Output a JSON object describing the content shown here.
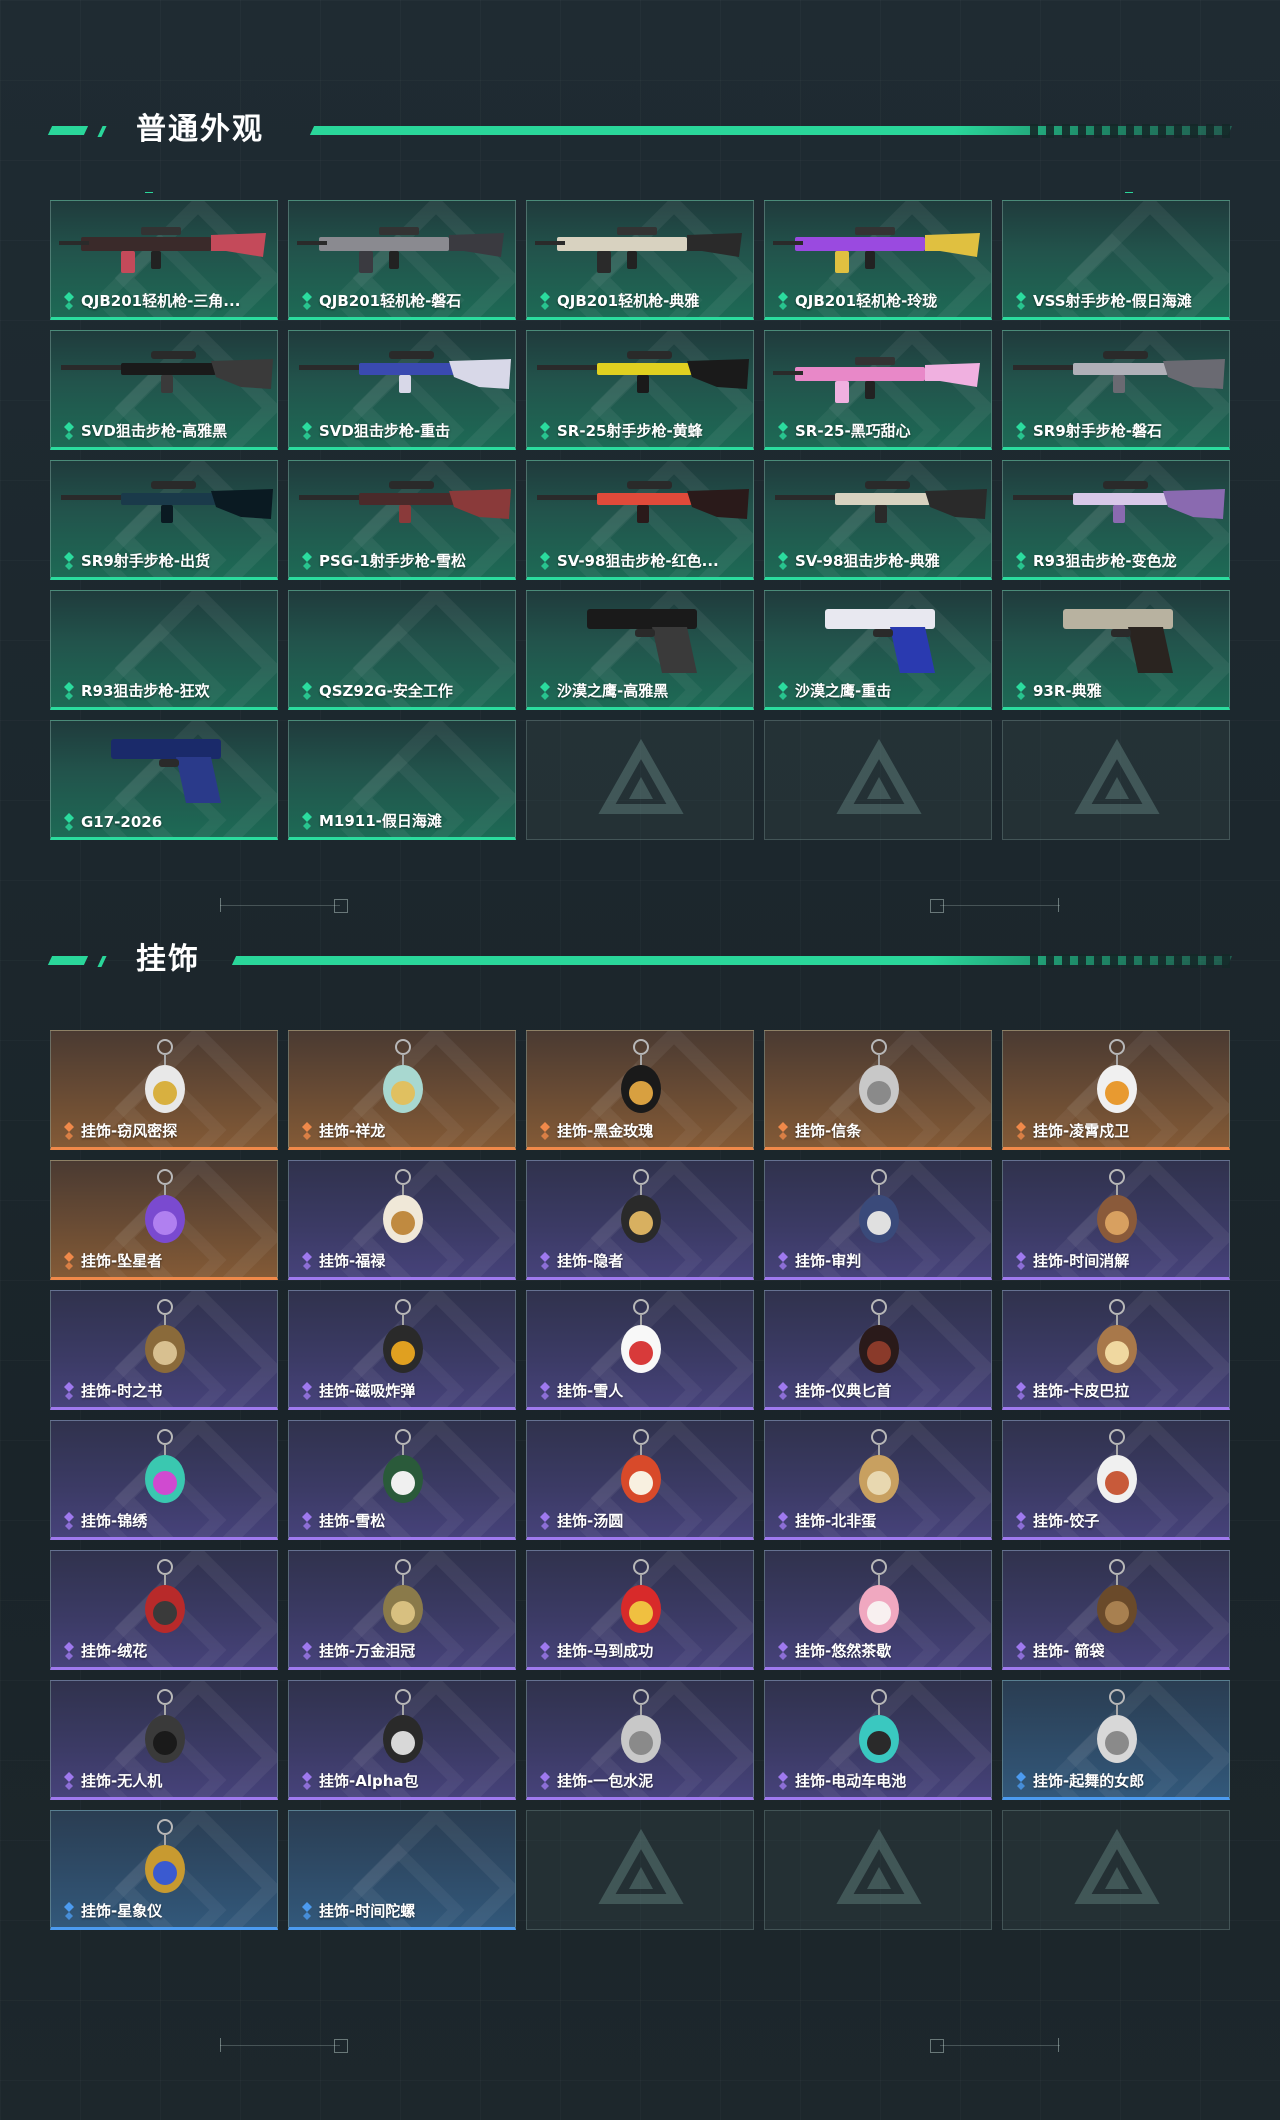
{
  "sections": {
    "skins": {
      "title": "普通外观",
      "items": [
        {
          "label": "QJB201轻机枪-三角...",
          "rarity": "green",
          "art": "rifle",
          "colors": [
            "#3a2a2a",
            "#c44a5a"
          ]
        },
        {
          "label": "QJB201轻机枪-磐石",
          "rarity": "green",
          "art": "rifle",
          "colors": [
            "#8a8a90",
            "#3a3a40"
          ]
        },
        {
          "label": "QJB201轻机枪-典雅",
          "rarity": "green",
          "art": "rifle",
          "colors": [
            "#d8d2c0",
            "#2a2a2a"
          ]
        },
        {
          "label": "QJB201轻机枪-玲珑",
          "rarity": "green",
          "art": "rifle",
          "colors": [
            "#9a4ae0",
            "#e0c040"
          ]
        },
        {
          "label": "VSS射手步枪-假日海滩",
          "rarity": "green",
          "art": "none",
          "colors": []
        },
        {
          "label": "SVD狙击步枪-高雅黑",
          "rarity": "green",
          "art": "sniper",
          "colors": [
            "#1a1a1a",
            "#3a3a3a"
          ]
        },
        {
          "label": "SVD狙击步枪-重击",
          "rarity": "green",
          "art": "sniper",
          "colors": [
            "#3a4ab0",
            "#d8d8e8"
          ]
        },
        {
          "label": "SR-25射手步枪-黄蜂",
          "rarity": "green",
          "art": "sniper",
          "colors": [
            "#e0d020",
            "#1a1a1a"
          ]
        },
        {
          "label": "SR-25-黑巧甜心",
          "rarity": "green",
          "art": "rifle",
          "colors": [
            "#e888c8",
            "#f0b0e0"
          ]
        },
        {
          "label": "SR9射手步枪-磐石",
          "rarity": "green",
          "art": "sniper",
          "colors": [
            "#b0b0b8",
            "#6a6a72"
          ]
        },
        {
          "label": "SR9射手步枪-出货",
          "rarity": "green",
          "art": "sniper",
          "colors": [
            "#1a3a4a",
            "#0a1a22"
          ]
        },
        {
          "label": "PSG-1射手步枪-雪松",
          "rarity": "green",
          "art": "sniper",
          "colors": [
            "#4a2a2a",
            "#8a3a3a"
          ]
        },
        {
          "label": "SV-98狙击步枪-红色...",
          "rarity": "green",
          "art": "sniper",
          "colors": [
            "#e04a3a",
            "#2a1a1a"
          ]
        },
        {
          "label": "SV-98狙击步枪-典雅",
          "rarity": "green",
          "art": "sniper",
          "colors": [
            "#d8d2c0",
            "#2a2a2a"
          ]
        },
        {
          "label": "R93狙击步枪-变色龙",
          "rarity": "green",
          "art": "sniper",
          "colors": [
            "#d8c8e8",
            "#8a6ab0"
          ]
        },
        {
          "label": "R93狙击步枪-狂欢",
          "rarity": "green",
          "art": "none",
          "colors": []
        },
        {
          "label": "QSZ92G-安全工作",
          "rarity": "green",
          "art": "none",
          "colors": []
        },
        {
          "label": "沙漠之鹰-高雅黑",
          "rarity": "green",
          "art": "pistol",
          "colors": [
            "#1a1a1a",
            "#3a3a3a"
          ]
        },
        {
          "label": "沙漠之鹰-重击",
          "rarity": "green",
          "art": "pistol",
          "colors": [
            "#e8e8f0",
            "#2a3ab0"
          ]
        },
        {
          "label": "93R-典雅",
          "rarity": "green",
          "art": "pistol",
          "colors": [
            "#b8b2a0",
            "#2a2420"
          ]
        },
        {
          "label": "G17-2026",
          "rarity": "green",
          "art": "pistol",
          "colors": [
            "#1a2a6a",
            "#2a3a8a"
          ]
        },
        {
          "label": "M1911-假日海滩",
          "rarity": "green",
          "art": "none",
          "colors": []
        },
        {
          "label": "",
          "rarity": "empty",
          "art": "logo",
          "colors": []
        },
        {
          "label": "",
          "rarity": "empty",
          "art": "logo",
          "colors": []
        },
        {
          "label": "",
          "rarity": "empty",
          "art": "logo",
          "colors": []
        }
      ]
    },
    "charms": {
      "title": "挂饰",
      "items": [
        {
          "label": "挂饰-窃风密探",
          "rarity": "orange",
          "art": "charm",
          "colors": [
            "#e8e8e8",
            "#d8b040"
          ]
        },
        {
          "label": "挂饰-祥龙",
          "rarity": "orange",
          "art": "charm",
          "colors": [
            "#a8d8d0",
            "#e0c060"
          ]
        },
        {
          "label": "挂饰-黑金玫瑰",
          "rarity": "orange",
          "art": "charm",
          "colors": [
            "#1a1a1a",
            "#d8a040"
          ]
        },
        {
          "label": "挂饰-信条",
          "rarity": "orange",
          "art": "charm",
          "colors": [
            "#c8c8c8",
            "#8a8a8a"
          ]
        },
        {
          "label": "挂饰-凌霄戍卫",
          "rarity": "orange",
          "art": "charm",
          "colors": [
            "#f0f0f0",
            "#e89a30"
          ]
        },
        {
          "label": "挂饰-坠星者",
          "rarity": "orange",
          "art": "charm",
          "colors": [
            "#7a4ad0",
            "#b080f0"
          ]
        },
        {
          "label": "挂饰-福禄",
          "rarity": "purple",
          "art": "charm",
          "colors": [
            "#f0e8d8",
            "#c08a40"
          ]
        },
        {
          "label": "挂饰-隐者",
          "rarity": "purple",
          "art": "charm",
          "colors": [
            "#2a2a2a",
            "#d8b060"
          ]
        },
        {
          "label": "挂饰-审判",
          "rarity": "purple",
          "art": "charm",
          "colors": [
            "#3a4a7a",
            "#e0e0e0"
          ]
        },
        {
          "label": "挂饰-时间消解",
          "rarity": "purple",
          "art": "charm",
          "colors": [
            "#8a5a3a",
            "#d8a060"
          ]
        },
        {
          "label": "挂饰-时之书",
          "rarity": "purple",
          "art": "charm",
          "colors": [
            "#8a6a3a",
            "#d8c090"
          ]
        },
        {
          "label": "挂饰-磁吸炸弹",
          "rarity": "purple",
          "art": "charm",
          "colors": [
            "#2a2a2a",
            "#e0a020"
          ]
        },
        {
          "label": "挂饰-雪人",
          "rarity": "purple",
          "art": "charm",
          "colors": [
            "#f8f8f8",
            "#d83a3a"
          ]
        },
        {
          "label": "挂饰-仪典匕首",
          "rarity": "purple",
          "art": "charm",
          "colors": [
            "#2a1a1a",
            "#8a3a2a"
          ]
        },
        {
          "label": "挂饰-卡皮巴拉",
          "rarity": "purple",
          "art": "charm",
          "colors": [
            "#a8784a",
            "#f0d8a0"
          ]
        },
        {
          "label": "挂饰-锦绣",
          "rarity": "purple",
          "art": "charm",
          "colors": [
            "#3ac8b0",
            "#d04ad0"
          ]
        },
        {
          "label": "挂饰-雪松",
          "rarity": "purple",
          "art": "charm",
          "colors": [
            "#2a5a3a",
            "#f0f0f0"
          ]
        },
        {
          "label": "挂饰-汤圆",
          "rarity": "purple",
          "art": "charm",
          "colors": [
            "#d84a2a",
            "#f8f0e0"
          ]
        },
        {
          "label": "挂饰-北非蛋",
          "rarity": "purple",
          "art": "charm",
          "colors": [
            "#c8a060",
            "#e8d8b0"
          ]
        },
        {
          "label": "挂饰-饺子",
          "rarity": "purple",
          "art": "charm",
          "colors": [
            "#f0f0f0",
            "#c85a3a"
          ]
        },
        {
          "label": "挂饰-绒花",
          "rarity": "purple",
          "art": "charm",
          "colors": [
            "#b82a2a",
            "#3a3a3a"
          ]
        },
        {
          "label": "挂饰-万金泪冠",
          "rarity": "purple",
          "art": "charm",
          "colors": [
            "#8a7a4a",
            "#d8c080"
          ]
        },
        {
          "label": "挂饰-马到成功",
          "rarity": "purple",
          "art": "charm",
          "colors": [
            "#d82a2a",
            "#f0c040"
          ]
        },
        {
          "label": "挂饰-悠然茶歇",
          "rarity": "purple",
          "art": "charm",
          "colors": [
            "#f0a8c0",
            "#f8f0f0"
          ]
        },
        {
          "label": "挂饰- 箭袋",
          "rarity": "purple",
          "art": "charm",
          "colors": [
            "#6a4a2a",
            "#a88050"
          ]
        },
        {
          "label": "挂饰-无人机",
          "rarity": "purple",
          "art": "charm",
          "colors": [
            "#3a3a3a",
            "#1a1a1a"
          ]
        },
        {
          "label": "挂饰-Alpha包",
          "rarity": "purple",
          "art": "charm",
          "colors": [
            "#2a2a2a",
            "#d8d8d8"
          ]
        },
        {
          "label": "挂饰-一包水泥",
          "rarity": "purple",
          "art": "charm",
          "colors": [
            "#c8c8c8",
            "#8a8a8a"
          ]
        },
        {
          "label": "挂饰-电动车电池",
          "rarity": "purple",
          "art": "charm",
          "colors": [
            "#3ac8c0",
            "#2a2a2a"
          ]
        },
        {
          "label": "挂饰-起舞的女郎",
          "rarity": "blue",
          "art": "charm",
          "colors": [
            "#d8d8d8",
            "#8a8a8a"
          ]
        },
        {
          "label": "挂饰-星象仪",
          "rarity": "blue",
          "art": "charm",
          "colors": [
            "#c89a30",
            "#3a5ad0"
          ]
        },
        {
          "label": "挂饰-时间陀螺",
          "rarity": "blue",
          "art": "none",
          "colors": []
        },
        {
          "label": "",
          "rarity": "empty",
          "art": "logo",
          "colors": []
        },
        {
          "label": "",
          "rarity": "empty",
          "art": "logo",
          "colors": []
        },
        {
          "label": "",
          "rarity": "empty",
          "art": "logo",
          "colors": []
        }
      ]
    }
  },
  "rarity_colors": {
    "green": "#2bdc9e",
    "orange": "#f0894a",
    "purple": "#9f79ef",
    "blue": "#4c9bf0"
  }
}
